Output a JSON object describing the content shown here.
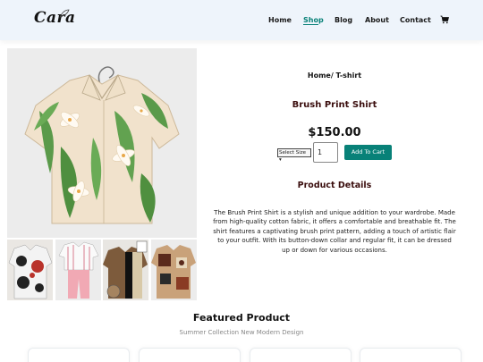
{
  "header": {
    "logo_text": "Cara",
    "nav": [
      {
        "label": "Home",
        "active": false
      },
      {
        "label": "Shop",
        "active": true
      },
      {
        "label": "Blog",
        "active": false
      },
      {
        "label": "About",
        "active": false
      },
      {
        "label": "Contact",
        "active": false
      }
    ],
    "cart_icon": "shopping-cart-icon",
    "accent_color": "#088178"
  },
  "product": {
    "breadcrumb": "Home/ T-shirt",
    "name": "Brush Print Shirt",
    "price": "$150.00",
    "size_select": "Select Size",
    "quantity": "1",
    "add_to_cart": "Add To Cart",
    "details_heading": "Product Details",
    "description": "The Brush Print Shirt is a stylish and unique addition to your wardrobe. Made from high-quality cotton fabric, it offers a comfortable and breathable fit. The shirt features a captivating brush print pattern, adding a touch of artistic flair to your outfit. With its button-down collar and regular fit, it can be dressed up or down for various occasions."
  },
  "thumbnails": [
    {
      "name": "circle-print-shirt-thumb"
    },
    {
      "name": "striped-pink-outfit-thumb"
    },
    {
      "name": "brown-panel-shirt-thumb"
    },
    {
      "name": "patchwork-print-shirt-thumb"
    }
  ],
  "featured": {
    "title": "Featured Product",
    "subtitle": "Summer Collection New Modern Design"
  }
}
